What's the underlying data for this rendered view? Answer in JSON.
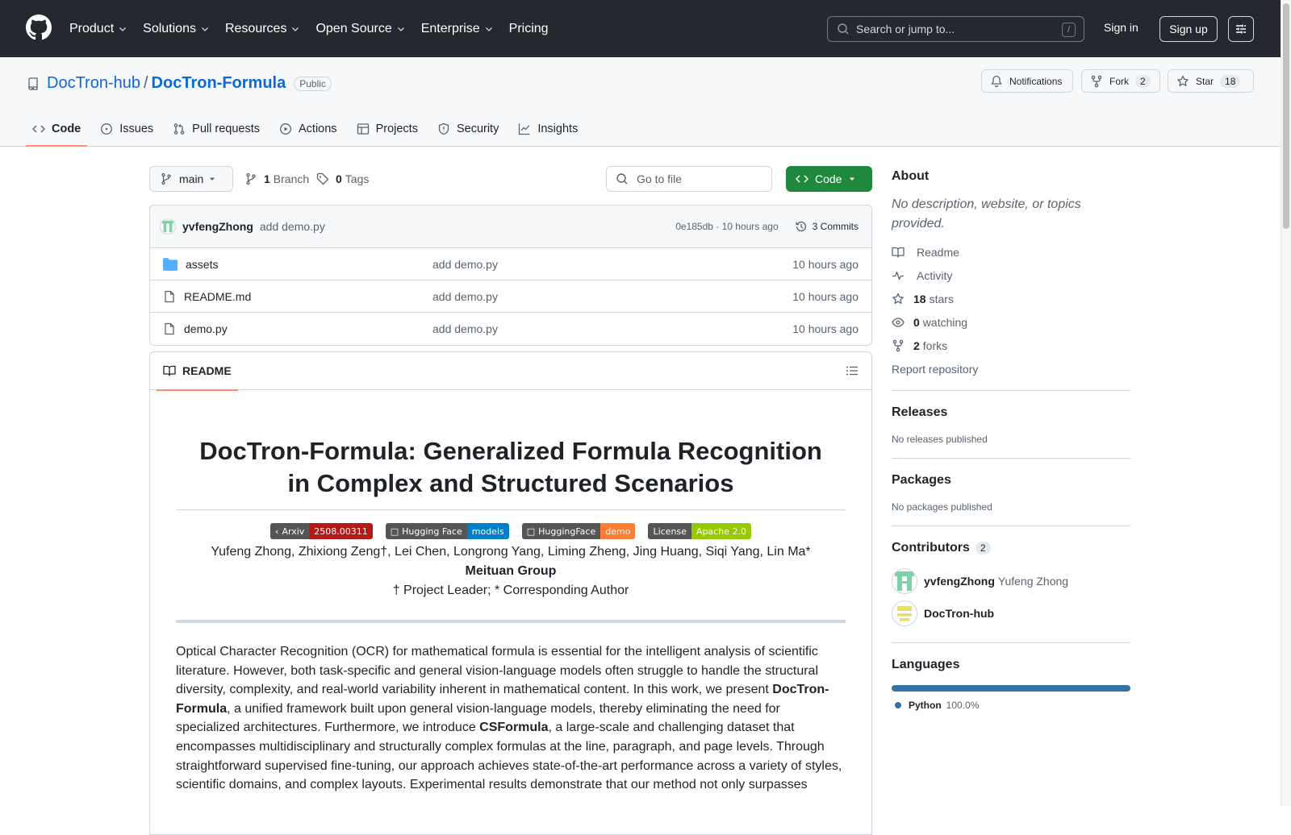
{
  "header": {
    "nav": [
      "Product",
      "Solutions",
      "Resources",
      "Open Source",
      "Enterprise",
      "Pricing"
    ],
    "search_placeholder": "Search or jump to...",
    "search_shortcut": "/",
    "sign_in": "Sign in",
    "sign_up": "Sign up"
  },
  "repo": {
    "owner": "DocTron-hub",
    "separator": "/",
    "name": "DocTron-Formula",
    "visibility": "Public",
    "notifications": "Notifications",
    "fork_label": "Fork",
    "fork_count": "2",
    "star_label": "Star",
    "star_count": "18"
  },
  "tabs": [
    "Code",
    "Issues",
    "Pull requests",
    "Actions",
    "Projects",
    "Security",
    "Insights"
  ],
  "toolbar": {
    "branch": "main",
    "branch_count": "1",
    "branch_label": "Branch",
    "tag_count": "0",
    "tag_label": "Tags",
    "go_to_file": "Go to file",
    "code_button": "Code"
  },
  "latest_commit": {
    "author": "yvfengZhong",
    "message": "add demo.py",
    "sha_time": "0e185db · 10 hours ago",
    "commits": "3 Commits"
  },
  "files": [
    {
      "name": "assets",
      "type": "folder",
      "commit": "add demo.py",
      "time": "10 hours ago"
    },
    {
      "name": "README.md",
      "type": "file",
      "commit": "add demo.py",
      "time": "10 hours ago"
    },
    {
      "name": "demo.py",
      "type": "file",
      "commit": "add demo.py",
      "time": "10 hours ago"
    }
  ],
  "readme": {
    "tab": "README",
    "title_line1": "DocTron-Formula: Generalized Formula Recognition",
    "title_line2": "in Complex and Structured Scenarios",
    "badges": [
      {
        "left": "Arxiv",
        "right": "2508.00311",
        "color": "#b31b1b",
        "icon": "arxiv-icon"
      },
      {
        "left": "Hugging Face",
        "right": "models",
        "color": "#007ec6",
        "icon": "huggingface-icon"
      },
      {
        "left": "HuggingFace",
        "right": "demo",
        "color": "#fe7d37",
        "icon": "huggingface-icon"
      },
      {
        "left": "License",
        "right": "Apache 2.0",
        "color": "#97ca00",
        "icon": ""
      }
    ],
    "authors": "Yufeng Zhong, Zhixiong Zeng†, Lei Chen, Longrong Yang, Liming Zheng, Jing Huang, Siqi Yang, Lin Ma*",
    "group": "Meituan Group",
    "note": "† Project Leader; * Corresponding Author",
    "abstract_parts": [
      "Optical Character Recognition (OCR) for mathematical formula is essential for the intelligent analysis of scientific literature. However, both task-specific and general vision-language models often struggle to handle the structural diversity, complexity, and real-world variability inherent in mathematical content. In this work, we present ",
      "DocTron-Formula",
      ", a unified framework built upon general vision-language models, thereby eliminating the need for specialized architectures. Furthermore, we introduce ",
      "CSFormula",
      ", a large-scale and challenging dataset that encompasses multidisciplinary and structurally complex formulas at the line, paragraph, and page levels. Through straightforward supervised fine-tuning, our approach achieves state-of-the-art performance across a variety of styles, scientific domains, and complex layouts. Experimental results demonstrate that our method not only surpasses"
    ]
  },
  "sidebar": {
    "about_title": "About",
    "about_desc": "No description, website, or topics provided.",
    "links": [
      {
        "icon": "book-icon",
        "bold": "",
        "label": "Readme"
      },
      {
        "icon": "pulse-icon",
        "bold": "",
        "label": "Activity"
      },
      {
        "icon": "star-icon",
        "bold": "18",
        "label": "stars"
      },
      {
        "icon": "eye-icon",
        "bold": "0",
        "label": "watching"
      },
      {
        "icon": "fork-icon",
        "bold": "2",
        "label": "forks"
      }
    ],
    "report": "Report repository",
    "releases_title": "Releases",
    "releases_sub": "No releases published",
    "packages_title": "Packages",
    "packages_sub": "No packages published",
    "contributors_title": "Contributors",
    "contributors_count": "2",
    "contributors": [
      {
        "login": "yvfengZhong",
        "name": "Yufeng Zhong"
      },
      {
        "login": "DocTron-hub",
        "name": ""
      }
    ],
    "languages_title": "Languages",
    "languages": [
      {
        "name": "Python",
        "percent": "100.0%",
        "color": "#3572A5"
      }
    ]
  }
}
